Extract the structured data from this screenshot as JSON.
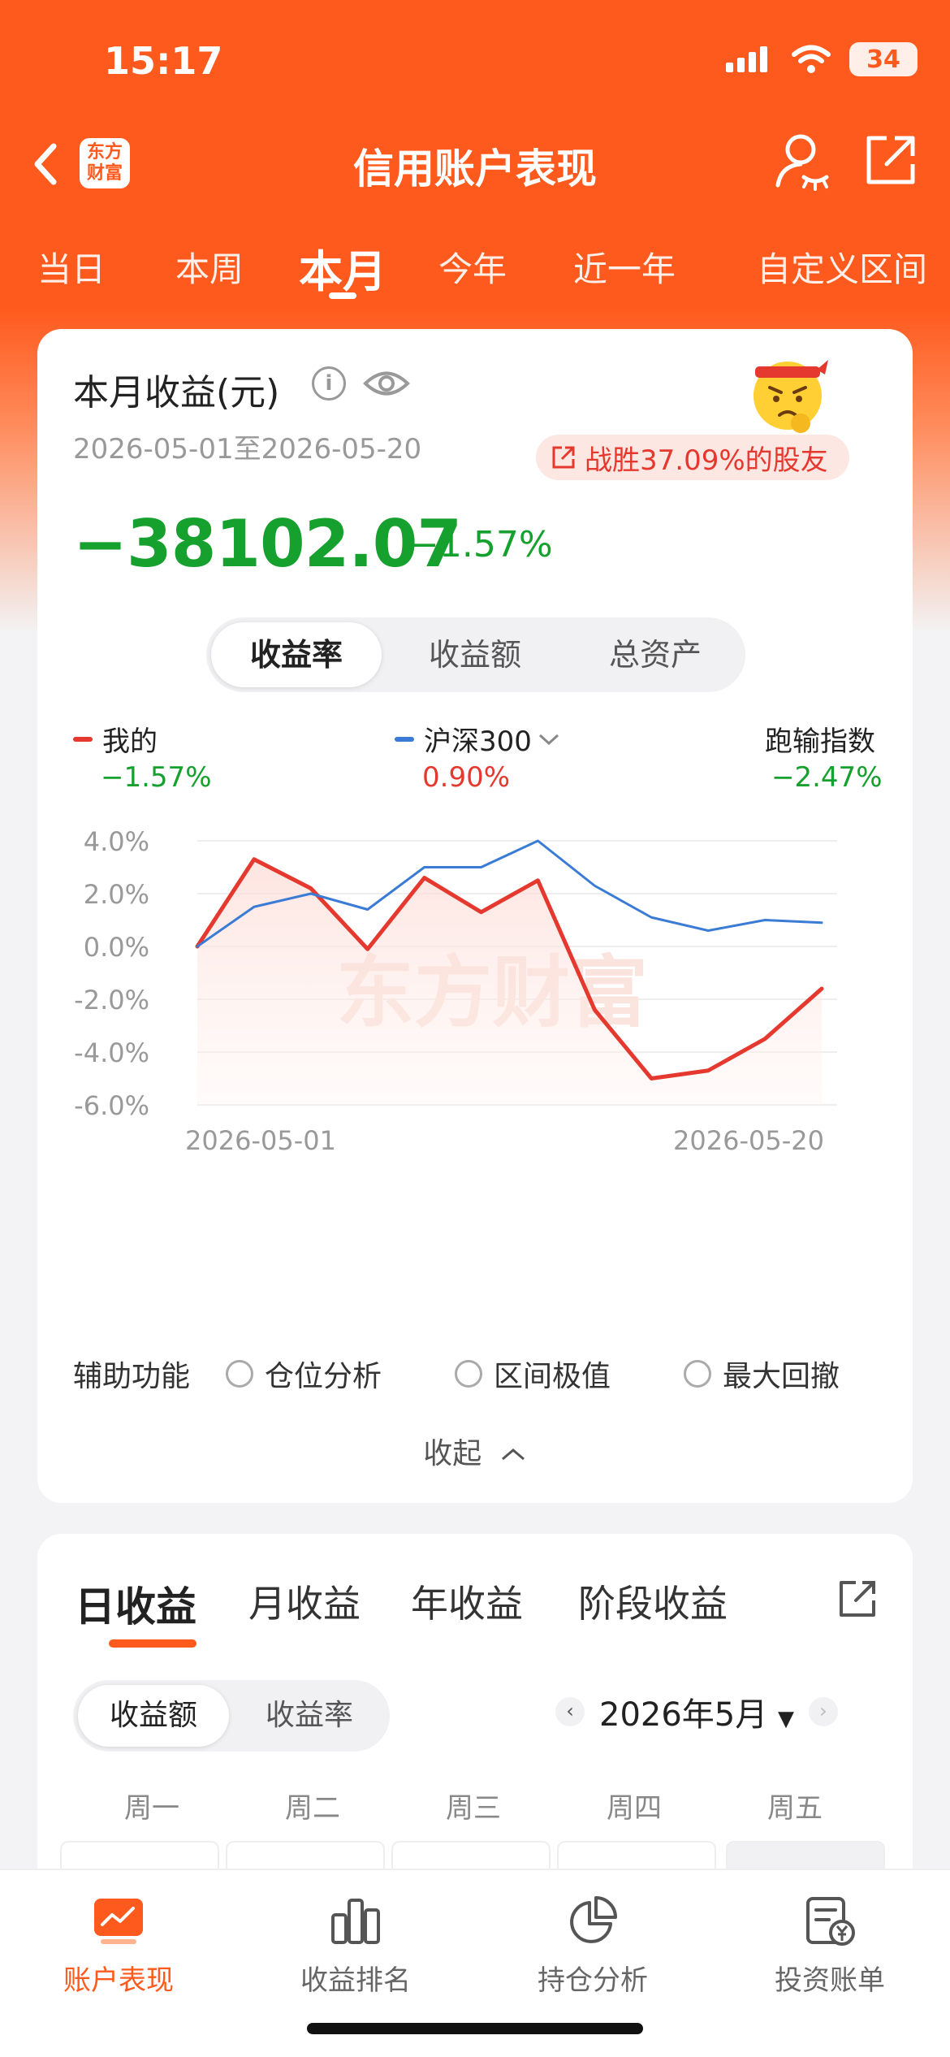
{
  "status_bar": {
    "time": "15:17",
    "battery": "34"
  },
  "nav": {
    "logo_line1": "东方",
    "logo_line2": "财富",
    "title": "信用账户表现"
  },
  "period_tabs": [
    {
      "label": "当日"
    },
    {
      "label": "本周"
    },
    {
      "label": "本月",
      "active": true
    },
    {
      "label": "今年"
    },
    {
      "label": "近一年"
    },
    {
      "label": "自定义区间"
    }
  ],
  "summary": {
    "title": "本月收益(元)",
    "date_range": "2026-05-01至2026-05-20",
    "beat_text": "战胜37.09%的股友",
    "value": "−38102.07",
    "pct": "−1.57%"
  },
  "metric_tabs": [
    {
      "label": "收益率",
      "active": true
    },
    {
      "label": "收益额"
    },
    {
      "label": "总资产"
    }
  ],
  "legend": {
    "mine": {
      "label": "我的",
      "value": "−1.57%",
      "color": "#e5392f"
    },
    "index": {
      "label": "沪深300",
      "value": "0.90%",
      "color": "#3a7bd5"
    },
    "diff": {
      "label": "跑输指数",
      "value": "−2.47%"
    }
  },
  "watermark": "东方财富",
  "chart_data": {
    "type": "line",
    "x": [
      "2026-05-01",
      "2026-05-04",
      "2026-05-05",
      "2026-05-06",
      "2026-05-07",
      "2026-05-08",
      "2026-05-11",
      "2026-05-12",
      "2026-05-13",
      "2026-05-14",
      "2026-05-15",
      "2026-05-18",
      "2026-05-19",
      "2026-05-20"
    ],
    "x_tick_labels": [
      "2026-05-01",
      "2026-05-20"
    ],
    "y_tick_labels": [
      "4.0%",
      "2.0%",
      "0.0%",
      "-2.0%",
      "-4.0%",
      "-6.0%"
    ],
    "ylim": [
      -6,
      4
    ],
    "grid": true,
    "series": [
      {
        "name": "我的",
        "color": "#e5392f",
        "values": [
          0.0,
          3.3,
          2.2,
          -0.1,
          2.6,
          1.3,
          2.5,
          -2.4,
          -5.0,
          -4.7,
          -3.5,
          -1.6
        ]
      },
      {
        "name": "沪深300",
        "color": "#3a7bd5",
        "values": [
          0.0,
          1.5,
          2.0,
          1.4,
          3.0,
          3.0,
          4.0,
          2.3,
          1.1,
          0.6,
          1.0,
          0.9
        ]
      }
    ]
  },
  "aux": {
    "label": "辅助功能",
    "options": [
      "仓位分析",
      "区间极值",
      "最大回撤"
    ],
    "collapse": "收起"
  },
  "earnings": {
    "tabs": [
      {
        "label": "日收益",
        "active": true
      },
      {
        "label": "月收益"
      },
      {
        "label": "年收益"
      },
      {
        "label": "阶段收益"
      }
    ],
    "segment": [
      {
        "label": "收益额",
        "active": true
      },
      {
        "label": "收益率"
      }
    ],
    "month": "2026年5月",
    "weekdays": [
      "周一",
      "周二",
      "周三",
      "周四",
      "周五"
    ]
  },
  "bottom_tabs": [
    {
      "label": "账户表现",
      "icon": "chart-card-icon",
      "active": true
    },
    {
      "label": "收益排名",
      "icon": "bar-chart-icon"
    },
    {
      "label": "持仓分析",
      "icon": "pie-chart-icon"
    },
    {
      "label": "投资账单",
      "icon": "bill-icon"
    }
  ]
}
